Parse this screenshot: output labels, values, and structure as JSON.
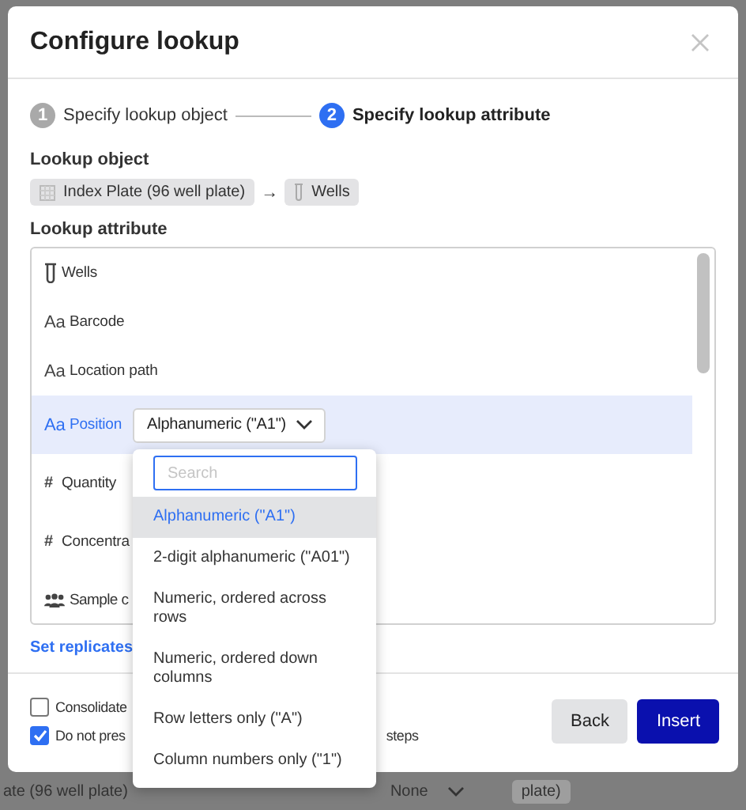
{
  "dialog": {
    "title": "Configure lookup",
    "steps": [
      {
        "number": "1",
        "label": "Specify lookup object",
        "selected": false
      },
      {
        "number": "2",
        "label": "Specify lookup attribute",
        "selected": true
      }
    ],
    "lookup_object": {
      "label": "Lookup object",
      "path": [
        {
          "kind": "plate",
          "label": "Index Plate (96 well plate)"
        },
        {
          "kind": "tube",
          "label": "Wells"
        }
      ],
      "separator": "→"
    },
    "lookup_attribute": {
      "label": "Lookup attribute",
      "items": [
        {
          "kind": "relation",
          "label": "Wells",
          "selected": false
        },
        {
          "kind": "text",
          "icon": "Aa",
          "label": "Barcode",
          "selected": false
        },
        {
          "kind": "text",
          "icon": "Aa",
          "label": "Location path",
          "selected": false
        },
        {
          "kind": "text",
          "icon": "Aa",
          "label": "Position",
          "selected": true,
          "format_select": "Alphanumeric (\"A1\")"
        },
        {
          "kind": "number",
          "icon": "#",
          "label": "Quantity",
          "selected": false
        },
        {
          "kind": "number",
          "icon": "#",
          "label": "Concentra",
          "selected": false
        },
        {
          "kind": "people",
          "label": "Sample c",
          "selected": false
        }
      ]
    },
    "set_replicates_link": "Set replicates",
    "options": [
      {
        "label": "Consolidate",
        "checked": false
      },
      {
        "label": "Do not pres",
        "label_tail": "steps",
        "checked": true
      }
    ],
    "buttons": [
      {
        "kind": "secondary",
        "label": "Back"
      },
      {
        "kind": "primary",
        "label": "Insert"
      }
    ],
    "format_dropdown": {
      "search": {
        "placeholder": "Search"
      },
      "options": [
        {
          "label": "Alphanumeric (\"A1\")",
          "selected": true
        },
        {
          "label": "2-digit alphanumeric (\"A01\")",
          "selected": false
        },
        {
          "label": "Numeric, ordered across rows",
          "selected": false
        },
        {
          "label": "Numeric, ordered down columns",
          "selected": false
        },
        {
          "label": "Row letters only (\"A\")",
          "selected": false
        },
        {
          "label": "Column numbers only (\"1\")",
          "selected": false
        }
      ]
    }
  },
  "background": {
    "cell": "ate (96 well plate)",
    "select": "None",
    "chip": "plate)"
  }
}
